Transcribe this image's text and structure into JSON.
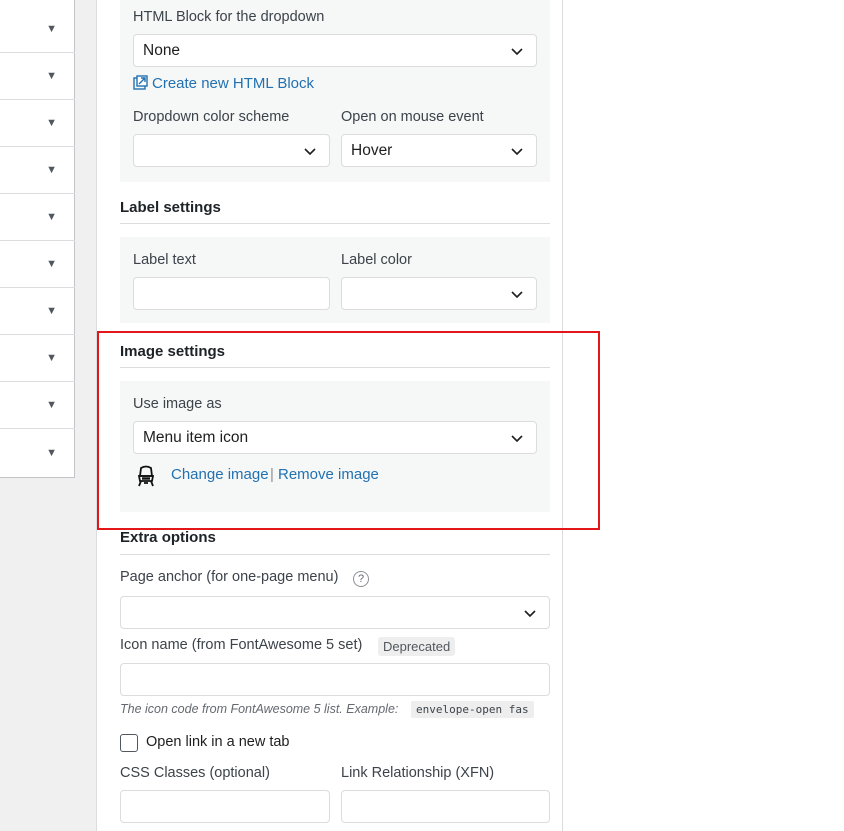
{
  "left_list": {
    "row_count": 10,
    "caret": "▼"
  },
  "dropdown_html_block": {
    "label": "HTML Block for the dropdown",
    "value": "None",
    "create_link": "Create new HTML Block"
  },
  "dropdown_color": {
    "label": "Dropdown color scheme",
    "value": ""
  },
  "open_event": {
    "label": "Open on mouse event",
    "value": "Hover"
  },
  "label_settings": {
    "heading": "Label settings",
    "text_label": "Label text",
    "text_value": "",
    "color_label": "Label color",
    "color_value": ""
  },
  "image_settings": {
    "heading": "Image settings",
    "use_label": "Use image as",
    "use_value": "Menu item icon",
    "change_link": "Change image",
    "separator": "|",
    "remove_link": "Remove image"
  },
  "extra": {
    "heading": "Extra options",
    "anchor_label": "Page anchor (for one-page menu)",
    "anchor_help": "?",
    "anchor_value": "",
    "icon_label": "Icon name (from FontAwesome 5 set)",
    "deprecated": "Deprecated",
    "icon_value": "",
    "icon_help": "The icon code from FontAwesome 5 list. Example:",
    "icon_example": "envelope-open fas",
    "new_tab_label": "Open link in a new tab",
    "css_label": "CSS Classes (optional)",
    "css_value": "",
    "xfn_label": "Link Relationship (XFN)",
    "xfn_value": ""
  },
  "colors": {
    "accent": "#2271b1",
    "highlight": "#e3171a"
  }
}
